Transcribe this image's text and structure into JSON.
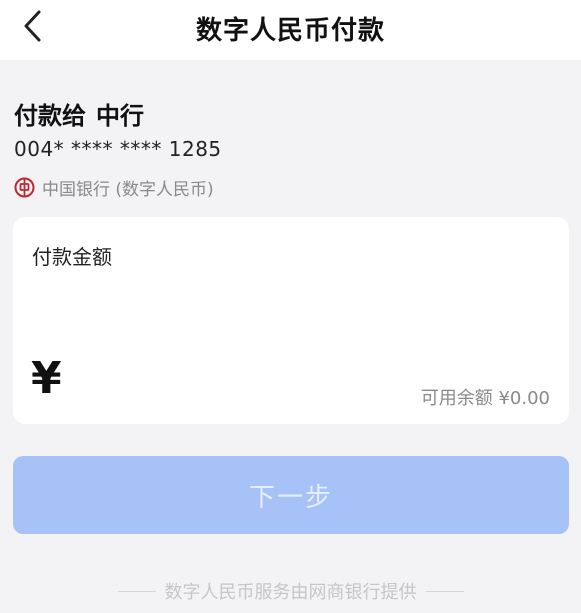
{
  "header": {
    "title": "数字人民币付款"
  },
  "payee": {
    "prefix": "付款给",
    "name": "中行",
    "account": "004* **** **** 1285",
    "bank": "中国银行 (数字人民币)"
  },
  "amount_card": {
    "label": "付款金额",
    "currency_symbol": "¥",
    "balance": "可用余额 ¥0.00"
  },
  "actions": {
    "next_label": "下一步"
  },
  "footer": {
    "text": "数字人民币服务由网商银行提供"
  },
  "colors": {
    "button_disabled": "#a6c2f7",
    "bank_logo": "#c0272d",
    "background": "#f3f3f5"
  },
  "icons": {
    "back": "back-arrow-icon",
    "bank": "bank-of-china-logo-icon"
  }
}
